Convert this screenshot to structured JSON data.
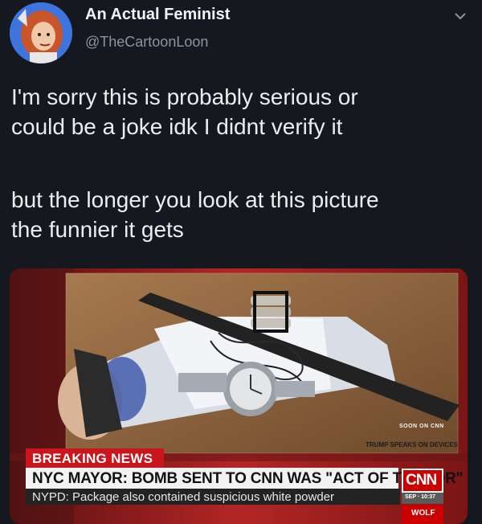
{
  "tweet": {
    "display_name": "An Actual Feminist",
    "handle": "@TheCartoonLoon",
    "lines": [
      "I'm sorry this is probably serious or",
      "could be a joke idk I didnt verify it",
      "",
      "but the longer you look at this picture",
      "the funnier it gets"
    ],
    "menu_icon": "chevron-down-icon"
  },
  "news_graphic": {
    "soon_label": "SOON ON CNN",
    "upcoming_label": "TRUMP SPEAKS ON DEVICES",
    "breaking_label": "BREAKING NEWS",
    "headline": "NYC MAYOR: BOMB SENT TO CNN WAS \"ACT OF TERROR\"",
    "subheadline": "NYPD: Package also contained suspicious white powder",
    "network_logo": "CNN",
    "time_text": "SEP · 10:37",
    "show_label": "WOLF",
    "colors": {
      "cnn_red": "#cc0000",
      "breaking_red": "#c9151b",
      "headline_bg": "#f2f2f2",
      "background": "#15181f"
    }
  }
}
